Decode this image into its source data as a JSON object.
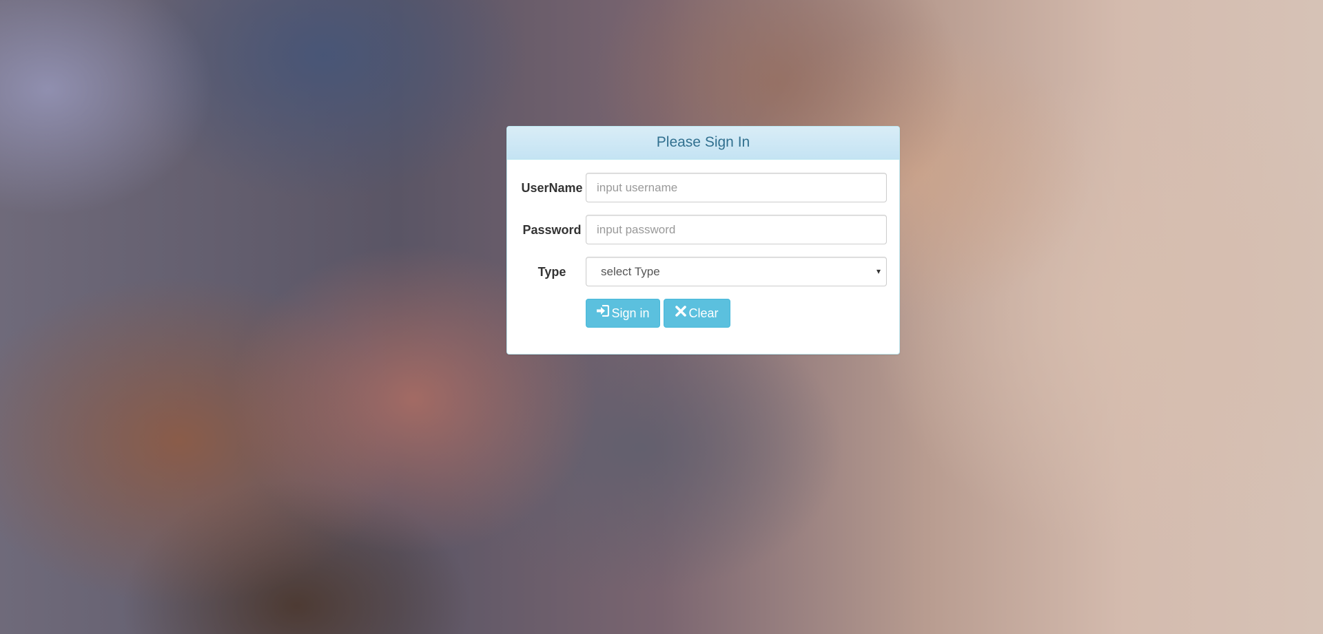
{
  "login": {
    "title": "Please Sign In",
    "username_label": "UserName",
    "username_placeholder": "input username",
    "password_label": "Password",
    "password_placeholder": "input password",
    "type_label": "Type",
    "type_selected": "select Type",
    "signin_label": "Sign in",
    "signin_icon": "sign-in-icon",
    "clear_label": "Clear",
    "clear_icon": "close-icon"
  },
  "colors": {
    "heading_text": "#31708f",
    "heading_bg": "#d9edf7",
    "button_bg": "#5bc0de"
  }
}
